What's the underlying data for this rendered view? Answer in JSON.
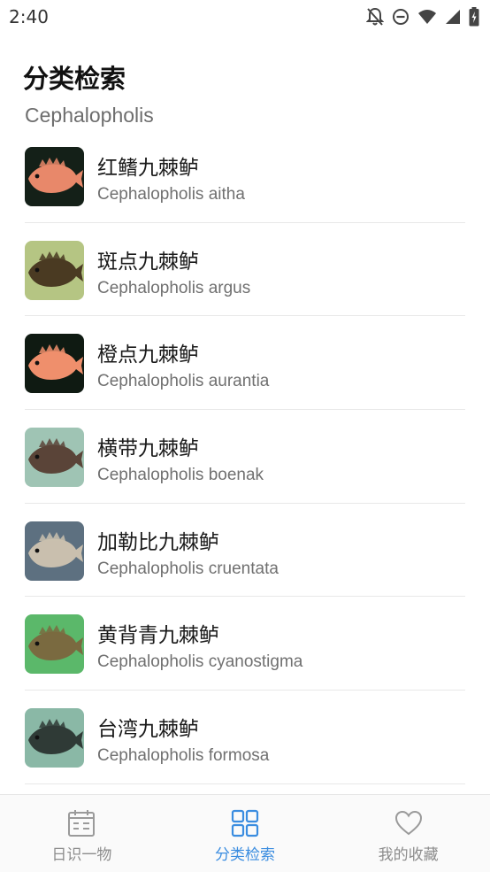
{
  "status_bar": {
    "time": "2:40",
    "icons": [
      "bell-off-icon",
      "do-not-disturb-icon",
      "wifi-icon",
      "signal-icon",
      "battery-charging-icon"
    ]
  },
  "header": {
    "title": "分类检索",
    "genus": "Cephalopholis"
  },
  "species": [
    {
      "cn": "红鳍九棘鲈",
      "latin": "Cephalopholis aitha",
      "thumb_bg": "#142018",
      "fish_color": "#e8886a"
    },
    {
      "cn": "斑点九棘鲈",
      "latin": "Cephalopholis argus",
      "thumb_bg": "#b5c583",
      "fish_color": "#4a3a22"
    },
    {
      "cn": "橙点九棘鲈",
      "latin": "Cephalopholis aurantia",
      "thumb_bg": "#0f1a12",
      "fish_color": "#ef8f6c"
    },
    {
      "cn": "横带九棘鲈",
      "latin": "Cephalopholis boenak",
      "thumb_bg": "#9fc4b4",
      "fish_color": "#5a4438"
    },
    {
      "cn": "加勒比九棘鲈",
      "latin": "Cephalopholis cruentata",
      "thumb_bg": "#5d7080",
      "fish_color": "#c9bfae"
    },
    {
      "cn": "黄背青九棘鲈",
      "latin": "Cephalopholis cyanostigma",
      "thumb_bg": "#5bb86a",
      "fish_color": "#7a6a40"
    },
    {
      "cn": "台湾九棘鲈",
      "latin": "Cephalopholis formosa",
      "thumb_bg": "#8ab8a6",
      "fish_color": "#2f3a36"
    }
  ],
  "bottom_nav": [
    {
      "label": "日识一物",
      "icon": "calendar-icon",
      "active": false
    },
    {
      "label": "分类检索",
      "icon": "grid-icon",
      "active": true
    },
    {
      "label": "我的收藏",
      "icon": "heart-icon",
      "active": false
    }
  ],
  "colors": {
    "accent": "#3b8de0",
    "inactive": "#8c8c8c",
    "divider": "#e8e8e8"
  }
}
